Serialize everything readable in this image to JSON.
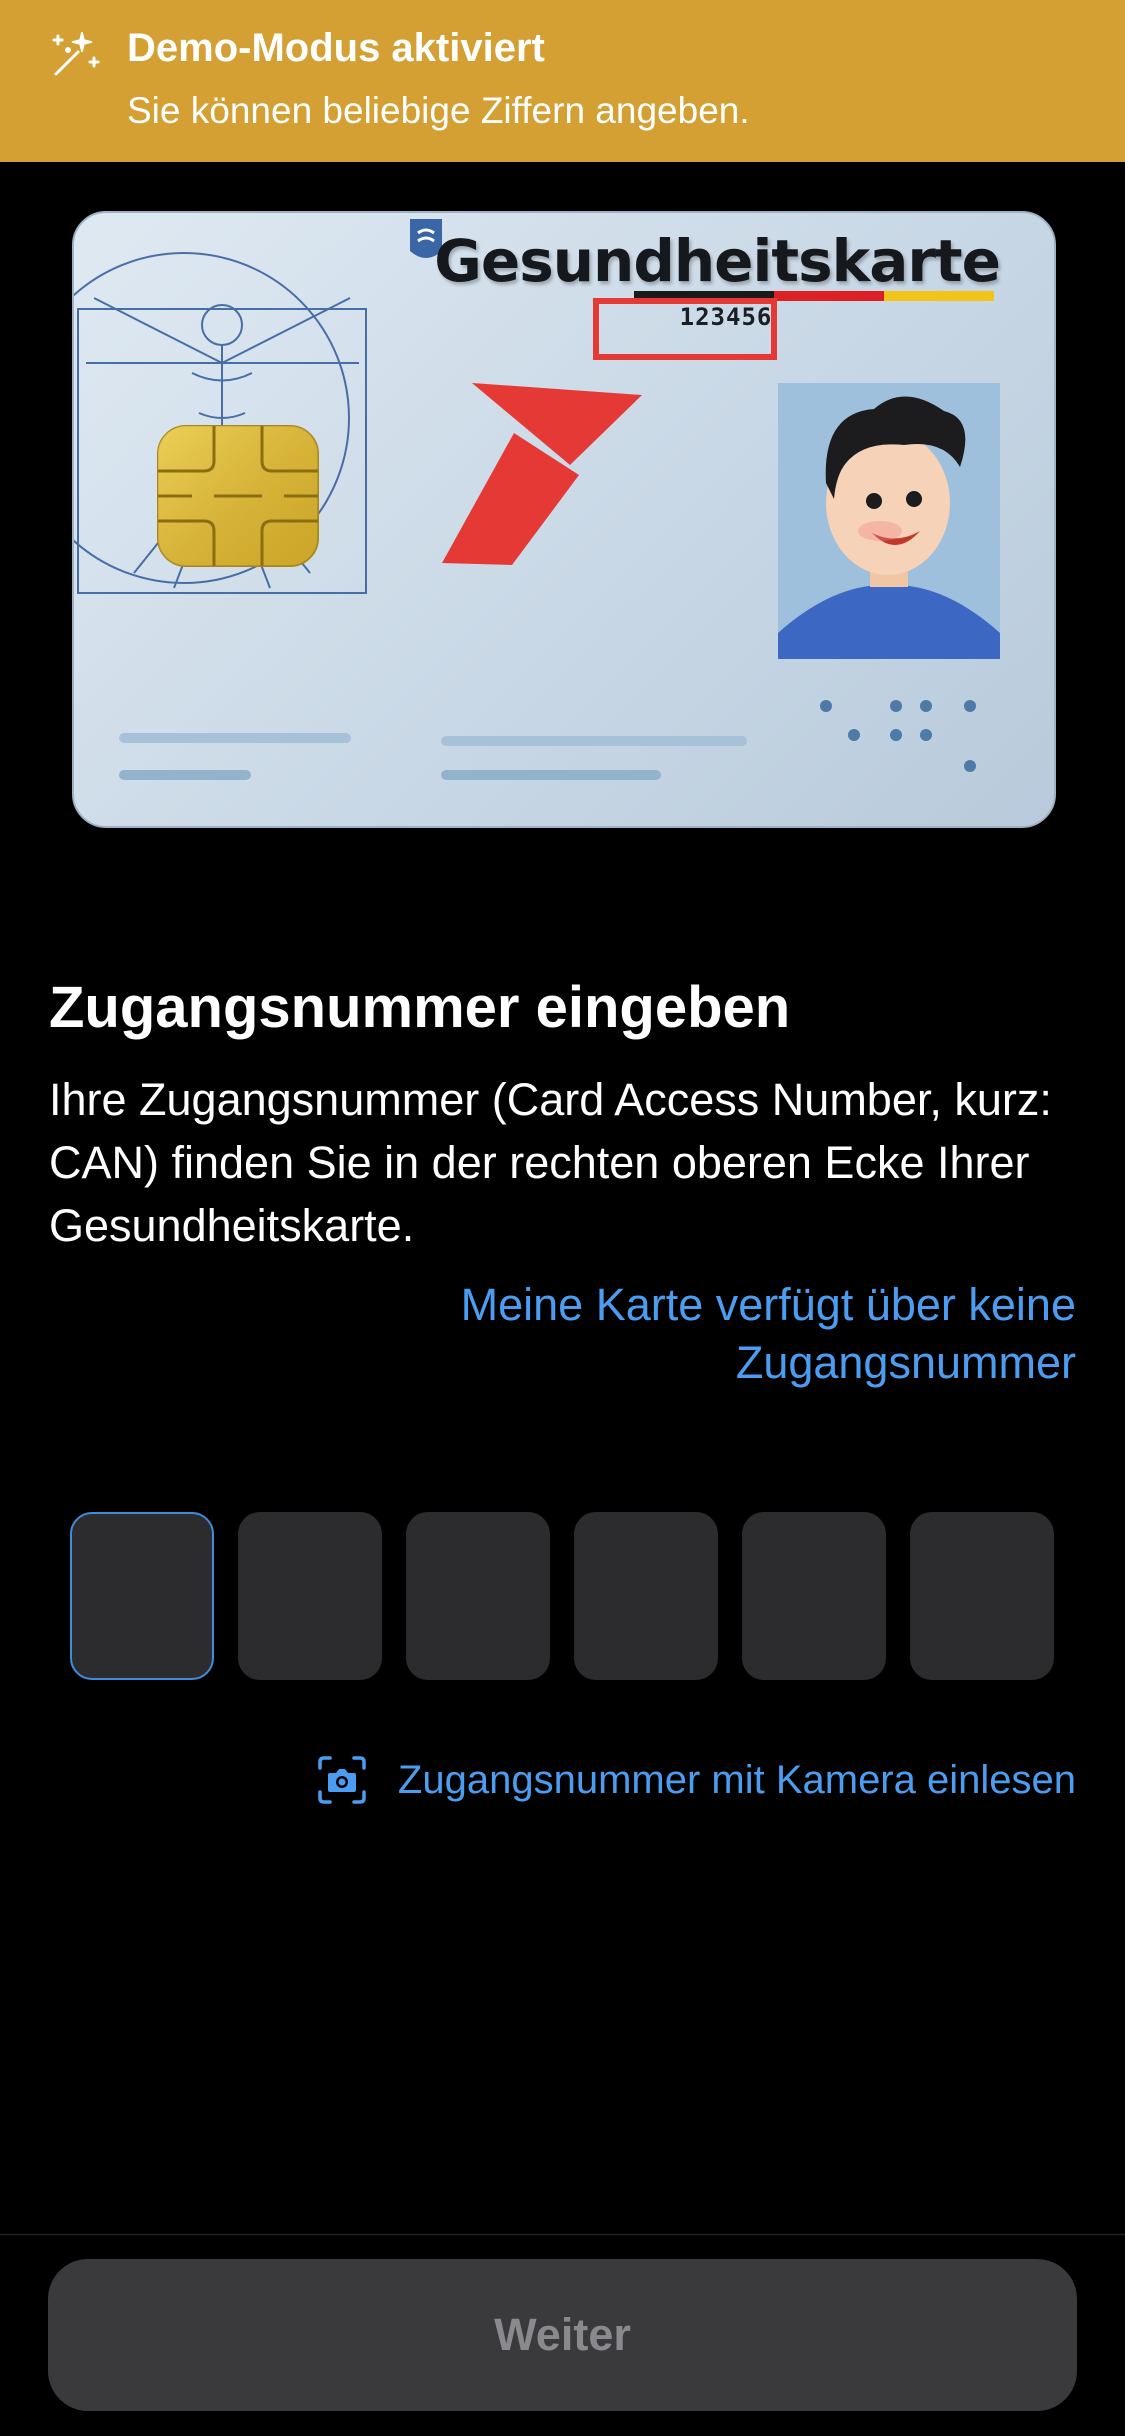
{
  "banner": {
    "title": "Demo-Modus aktiviert",
    "text": "Sie können beliebige Ziffern angeben.",
    "icon": "magic-wand-icon",
    "color": "#d49f33"
  },
  "card_illustration": {
    "title": "Gesundheitskarte",
    "can_example": "123456",
    "highlight_color": "#e53935"
  },
  "main": {
    "heading": "Zugangsnummer eingeben",
    "description": "Ihre Zugangsnummer (Card Access Number, kurz: CAN) finden Sie in der rechten oberen Ecke Ihrer Gesundheitskarte.",
    "no_can_link": "Meine Karte verfügt über keine Zugangsnummer",
    "link_color": "#4a9df0"
  },
  "can_input": {
    "digits": [
      "",
      "",
      "",
      "",
      "",
      ""
    ],
    "active_index": 0
  },
  "camera": {
    "label": "Zugangsnummer mit Kamera einlesen",
    "icon": "camera-scan-icon"
  },
  "footer": {
    "continue_label": "Weiter",
    "enabled": false
  }
}
